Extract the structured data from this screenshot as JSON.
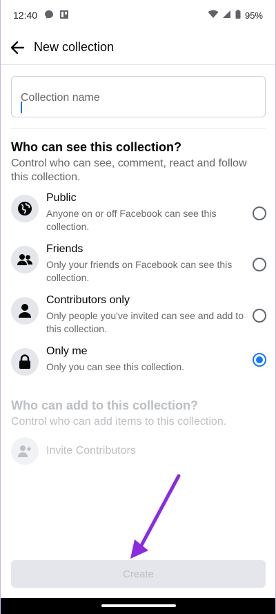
{
  "status_bar": {
    "time": "12:40",
    "battery": "95%",
    "icons": [
      "messenger-icon",
      "photo-icon",
      "wifi-icon",
      "signal-icon",
      "battery-icon"
    ]
  },
  "header": {
    "title": "New collection",
    "back_icon": "back-arrow-icon"
  },
  "collection_name": {
    "placeholder": "Collection name",
    "value": ""
  },
  "visibility": {
    "title": "Who can see this collection?",
    "subtitle": "Control who can see, comment, react and follow this collection.",
    "options": [
      {
        "icon": "globe-icon",
        "title": "Public",
        "description": "Anyone on or off Facebook can see this collection.",
        "selected": false
      },
      {
        "icon": "friends-icon",
        "title": "Friends",
        "description": "Only your friends on Facebook can see this collection.",
        "selected": false
      },
      {
        "icon": "person-icon",
        "title": "Contributors only",
        "description": "Only people you've invited can see and add to this collection.",
        "selected": false
      },
      {
        "icon": "lock-icon",
        "title": "Only me",
        "description": "Only you can see this collection.",
        "selected": true
      }
    ]
  },
  "contributors": {
    "title": "Who can add to this collection?",
    "subtitle": "Control who can add items to this collection.",
    "invite_label": "Invite Contributors"
  },
  "footer": {
    "create_label": "Create"
  },
  "colors": {
    "accent": "#1877f2",
    "annotation_arrow": "#8a2be2",
    "disabled_text": "#bcc0c4"
  }
}
